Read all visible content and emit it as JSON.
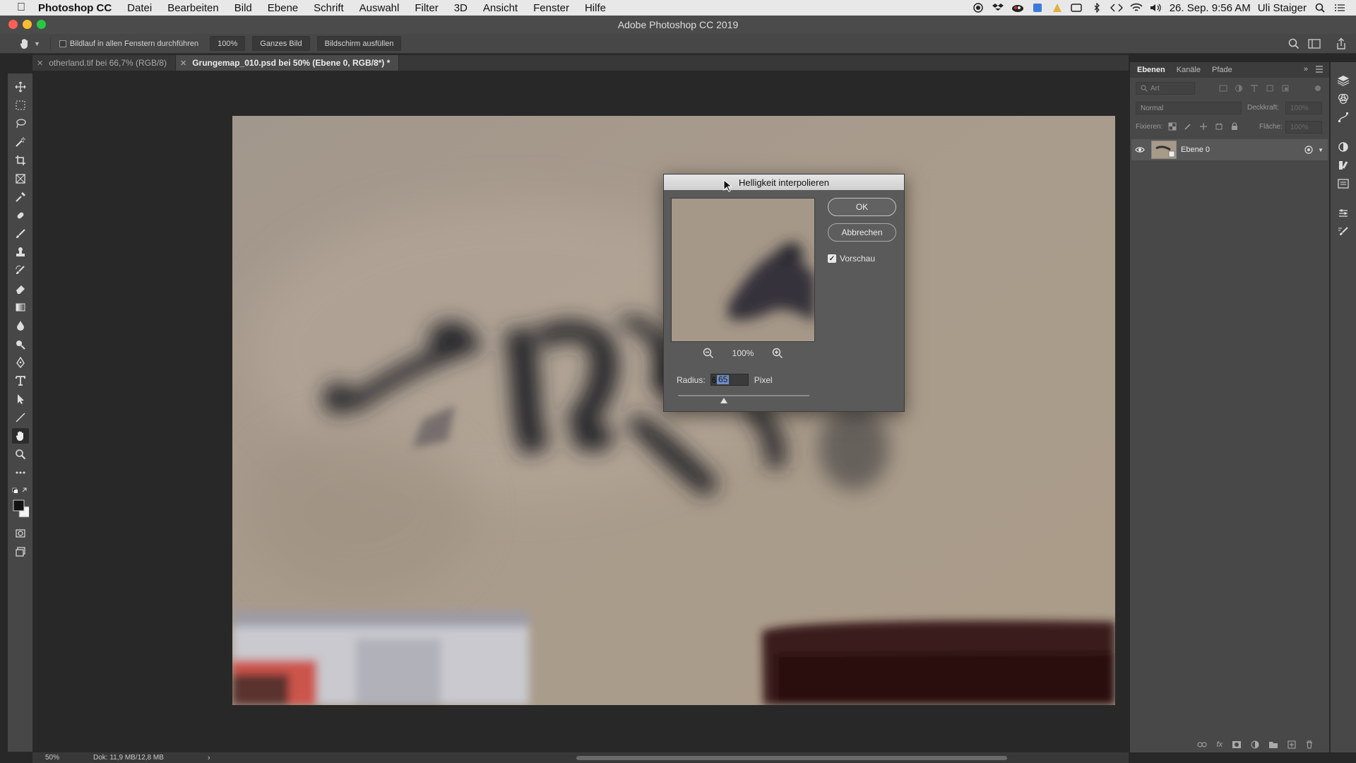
{
  "menubar": {
    "app_name": "Photoshop CC",
    "items": [
      "Datei",
      "Bearbeiten",
      "Bild",
      "Ebene",
      "Schrift",
      "Auswahl",
      "Filter",
      "3D",
      "Ansicht",
      "Fenster",
      "Hilfe"
    ],
    "datetime": "26. Sep. 9:56 AM",
    "user": "Uli Staiger"
  },
  "window": {
    "title": "Adobe Photoshop CC 2019"
  },
  "options": {
    "scroll_all_label": "Bildlauf in allen Fenstern durchführen",
    "zoom_btn": "100%",
    "fit_btn": "Ganzes Bild",
    "fill_btn": "Bildschirm ausfüllen"
  },
  "tabs": [
    {
      "label": "otherland.tif bei 66,7% (RGB/8)",
      "active": false
    },
    {
      "label": "Grungemap_010.psd bei 50% (Ebene 0, RGB/8*) *",
      "active": true
    }
  ],
  "dialog": {
    "title": "Helligkeit interpolieren",
    "ok": "OK",
    "cancel": "Abbrechen",
    "preview_label": "Vorschau",
    "preview_checked": true,
    "zoom": "100%",
    "radius_label": "Radius:",
    "radius_value": "65",
    "radius_unit": "Pixel",
    "slider_fraction": 0.35
  },
  "layers_panel": {
    "tabs": [
      "Ebenen",
      "Kanäle",
      "Pfade"
    ],
    "filter_placeholder": "Art",
    "blend_mode": "Normal",
    "opacity_label": "Deckkraft:",
    "opacity_value": "100%",
    "lock_label": "Fixieren:",
    "fill_label": "Fläche:",
    "fill_value": "100%",
    "layer_name": "Ebene 0"
  },
  "status": {
    "zoom": "50%",
    "doc_info": "Dok: 11,9 MB/12,8 MB"
  },
  "colors": {
    "accent": "#6f8fc9",
    "canvas": "#a6998a",
    "ui_dark": "#282828",
    "panel": "#484848"
  }
}
